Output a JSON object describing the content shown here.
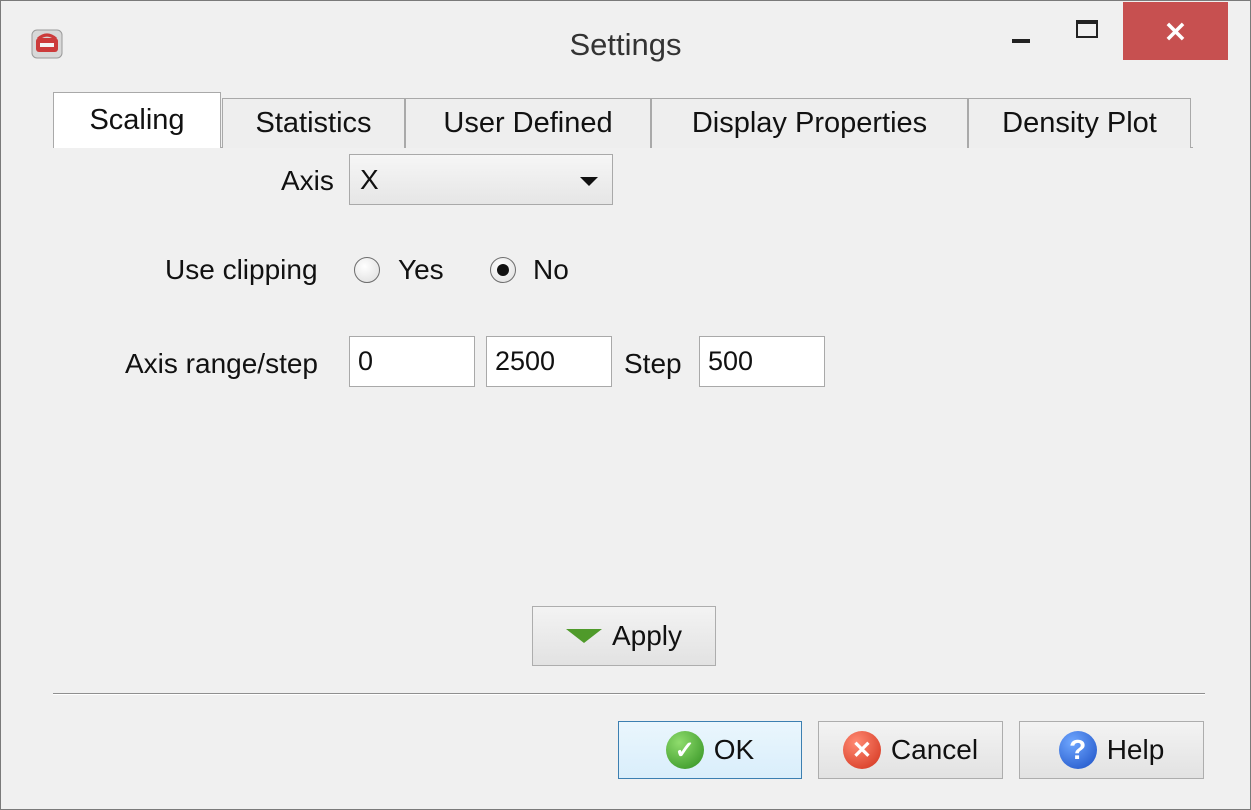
{
  "window": {
    "title": "Settings",
    "close_glyph": "×"
  },
  "tabs": [
    {
      "label": "Scaling",
      "active": true
    },
    {
      "label": "Statistics",
      "active": false
    },
    {
      "label": "User Defined",
      "active": false
    },
    {
      "label": "Display Properties",
      "active": false
    },
    {
      "label": "Density Plot",
      "active": false
    }
  ],
  "scaling": {
    "axis_label": "Axis",
    "axis_value": "X",
    "clipping_label": "Use clipping",
    "clipping_options": [
      {
        "label": "Yes",
        "selected": false
      },
      {
        "label": "No",
        "selected": true
      }
    ],
    "range_label": "Axis range/step",
    "range_min": "0",
    "range_max": "2500",
    "step_label": "Step",
    "step_value": "500",
    "apply_label": "Apply"
  },
  "footer": {
    "ok_label": "OK",
    "cancel_label": "Cancel",
    "help_label": "Help"
  },
  "colors": {
    "close_button": "#c75050",
    "apply_arrow": "#4f9a2a",
    "ok_icon": "#2f8f1f",
    "cancel_icon": "#d1301a",
    "help_icon": "#1b4fc4",
    "default_button_border": "#3c7fb1"
  },
  "icons": {
    "app": "app-logo-icon",
    "minimize": "minimize-icon",
    "maximize": "maximize-icon",
    "close": "close-icon",
    "dropdown": "chevron-down-icon",
    "apply": "apply-arrow-icon",
    "ok": "check-icon",
    "cancel": "cancel-x-icon",
    "help": "help-question-icon"
  }
}
